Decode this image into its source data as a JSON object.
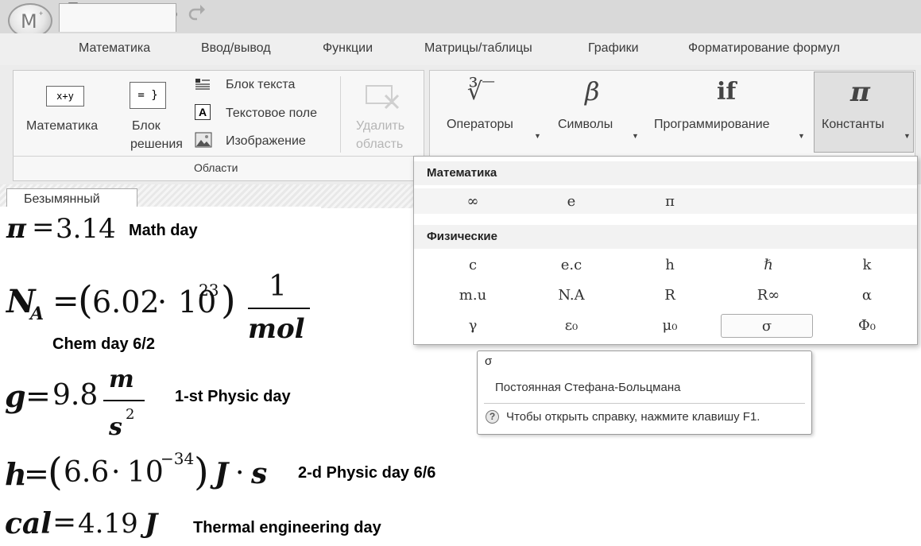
{
  "app": {
    "logo_letter": "M",
    "logo_mark": "+"
  },
  "quick_access": [
    "new-document-icon",
    "open-folder-icon",
    "save-icon",
    "undo-icon",
    "redo-icon"
  ],
  "tabs": [
    {
      "label": "Математика",
      "active": true
    },
    {
      "label": "Ввод/вывод"
    },
    {
      "label": "Функции"
    },
    {
      "label": "Матрицы/таблицы"
    },
    {
      "label": "Графики"
    },
    {
      "label": "Форматирование формул"
    }
  ],
  "ribbon": {
    "regions": {
      "math_icon": "x+y",
      "math_label": "Математика",
      "block_icon": "= }",
      "block_label_1": "Блок",
      "block_label_2": "решения",
      "text_block": "Блок текста",
      "text_field": "Текстовое поле",
      "image": "Изображение",
      "delete_1": "Удалить",
      "delete_2": "область",
      "group_label": "Области"
    },
    "operators": {
      "symbol": "∛‾",
      "label": "Операторы"
    },
    "symbols": {
      "symbol": "β",
      "label": "Символы"
    },
    "programming": {
      "symbol": "if",
      "label": "Программирование"
    },
    "constants": {
      "symbol": "π",
      "label": "Константы"
    }
  },
  "doc_tab": "Безымянный",
  "worksheet": {
    "eq1": {
      "var": "π",
      "eq": "=",
      "value": "3.14",
      "note": "Math day"
    },
    "eq2": {
      "var": "N",
      "sub": "A",
      "eq": "=",
      "open": "(",
      "mant": "6.02",
      "dot": "·",
      "base": "10",
      "exp": "23",
      "close": ")",
      "num": "1",
      "den": "mol",
      "note": "Chem day 6/2"
    },
    "eq3": {
      "var": "g",
      "eq": "=",
      "value": "9.8",
      "num": "m",
      "den": "s",
      "den_exp": "2",
      "note": "1-st Physic day"
    },
    "eq4": {
      "var": "h",
      "eq": "=",
      "open": "(",
      "mant": "6.6",
      "dot": "·",
      "base": "10",
      "exp": "−34",
      "close": ")",
      "unit": "J",
      "unit_dot": "·",
      "unit2": "s",
      "note": "2-d Physic day 6/6"
    },
    "eq5": {
      "var": "cal",
      "eq": "=",
      "value": "4.19",
      "unit": "J",
      "note": "Thermal engineering day"
    }
  },
  "dropdown": {
    "math_header": "Математика",
    "math_items": [
      "∞",
      "e",
      "π"
    ],
    "phys_header": "Физические",
    "phys_row1": [
      "c",
      "e.c",
      "h",
      "ℏ",
      "k"
    ],
    "phys_row2": [
      "m.u",
      "N.A",
      "R",
      "R∞",
      "α"
    ],
    "phys_row3": [
      "γ",
      "ε₀",
      "μ₀",
      "σ",
      "Φ₀"
    ],
    "selected": "σ"
  },
  "tooltip": {
    "symbol": "σ",
    "description": "Постоянная Стефана-Больцмана",
    "help_icon": "?",
    "help": "Чтобы открыть справку, нажмите клавишу F1."
  }
}
